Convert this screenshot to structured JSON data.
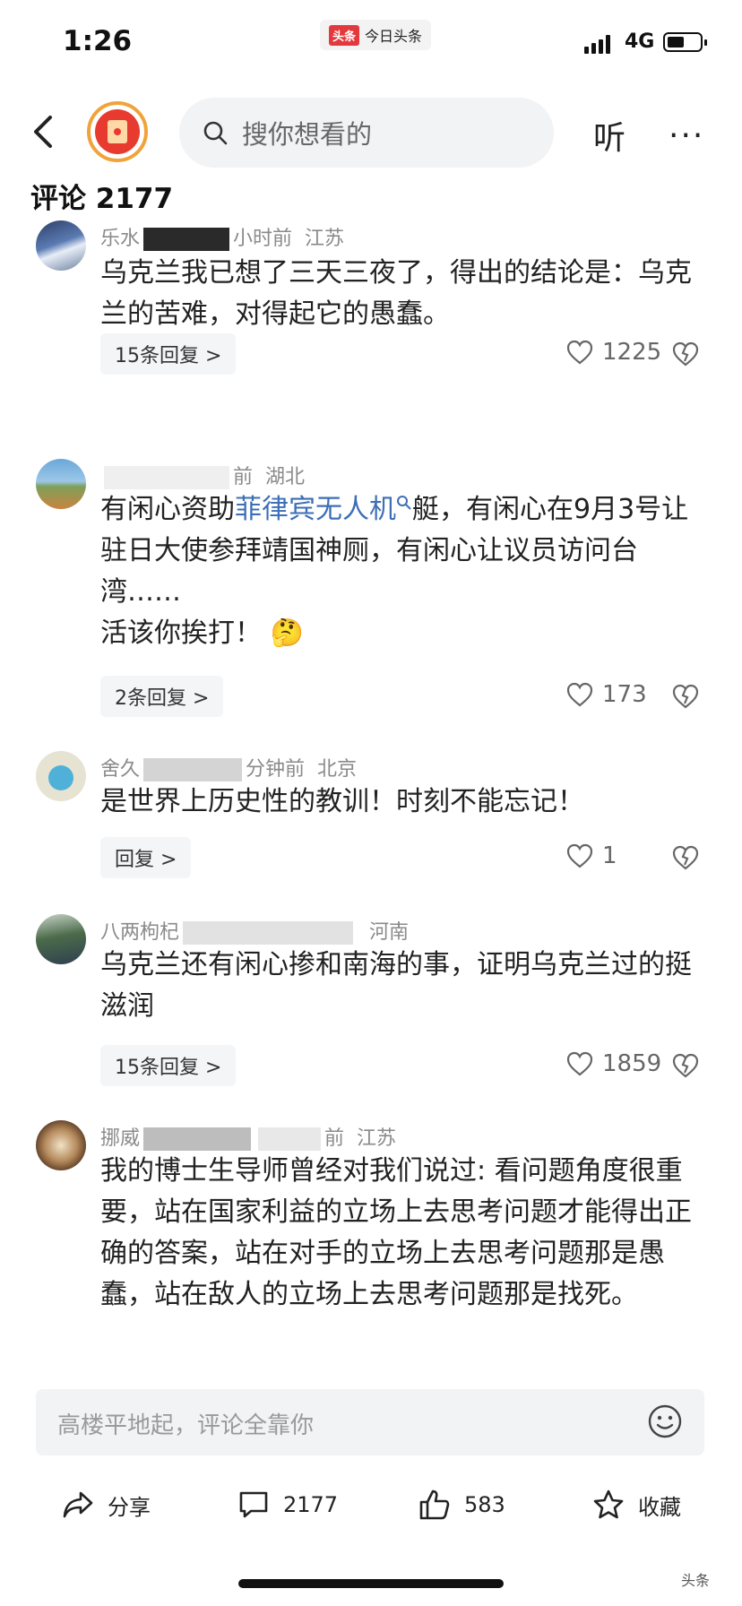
{
  "status": {
    "time": "1:26",
    "app_logo": "头条",
    "app_name": "今日头条",
    "network": "4G"
  },
  "nav": {
    "search_placeholder": "搜你想看的",
    "listen_label": "听",
    "more_label": "···"
  },
  "comments_header": {
    "label": "评论",
    "count": "2177"
  },
  "comments": [
    {
      "user": "乐水",
      "time": "小时前",
      "location": "江苏",
      "text": "乌克兰我已想了三天三夜了，得出的结论是：乌克兰的苦难，对得起它的愚蠢。",
      "replies": "15条回复 >",
      "likes": "1225"
    },
    {
      "user": "",
      "time": "前",
      "location": "湖北",
      "text_pre": "有闲心资助",
      "text_link": "菲律宾无人机",
      "text_post": "艇，有闲心在9月3号让驻日大使参拜靖国神厕，有闲心让议员访问台湾……",
      "text_line2": "活该你挨打！",
      "emoji": "🤔",
      "replies": "2条回复 >",
      "likes": "173"
    },
    {
      "user": "舍久",
      "time": "分钟前",
      "location": "北京",
      "text": "是世界上历史性的教训！时刻不能忘记！",
      "replies": "回复 >",
      "likes": "1"
    },
    {
      "user": "八两枸杞",
      "time": "",
      "location": "河南",
      "text": "乌克兰还有闲心掺和南海的事，证明乌克兰过的挺滋润",
      "replies": "15条回复 >",
      "likes": "1859"
    },
    {
      "user": "挪威",
      "time": "前",
      "location": "江苏",
      "text": "我的博士生导师曾经对我们说过: 看问题角度很重要，站在国家利益的立场上去思考问题才能得出正确的答案，站在对手的立场上去思考问题那是愚蠢，站在敌人的立场上去思考问题那是找死。"
    }
  ],
  "input": {
    "placeholder": "高楼平地起，评论全靠你"
  },
  "toolbar": {
    "share": "分享",
    "comments": "2177",
    "likes": "583",
    "favorite": "收藏"
  },
  "watermark": "头条"
}
